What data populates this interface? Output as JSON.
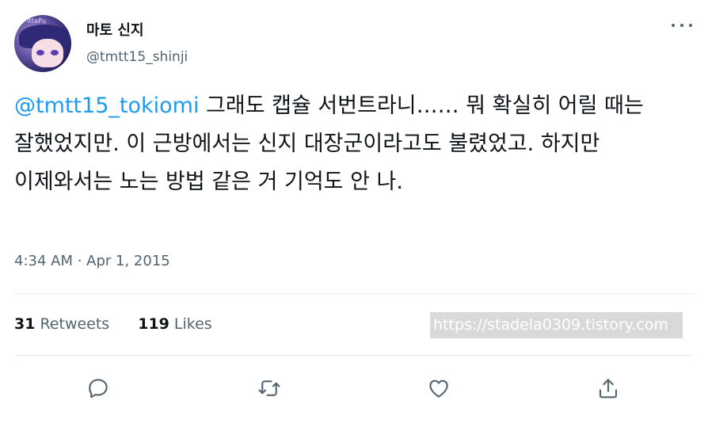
{
  "author": {
    "display_name": "마토 신지",
    "handle": "@tmtt15_shinji",
    "avatar_text": "ittaPu"
  },
  "tweet": {
    "mention": "@tmtt15_tokiomi",
    "text": " 그래도 캡슐 서번트라니…… 뭐 확실히 어릴 때는 잘했었지만. 이 근방에서는 신지 대장군이라고도 불렸었고. 하지만 이제와서는 노는 방법 같은 거 기억도 안 나.",
    "timestamp": "4:34 AM · Apr 1, 2015"
  },
  "stats": {
    "retweets_count": "31",
    "retweets_label": "Retweets",
    "likes_count": "119",
    "likes_label": "Likes"
  },
  "watermark": "https://stadela0309.tistory.com",
  "actions": {
    "reply": "reply-icon",
    "retweet": "retweet-icon",
    "like": "heart-icon",
    "share": "share-icon"
  },
  "colors": {
    "accent": "#1d9bf0",
    "text": "#0f1419",
    "secondary": "#536471",
    "divider": "#e6ecf0"
  }
}
